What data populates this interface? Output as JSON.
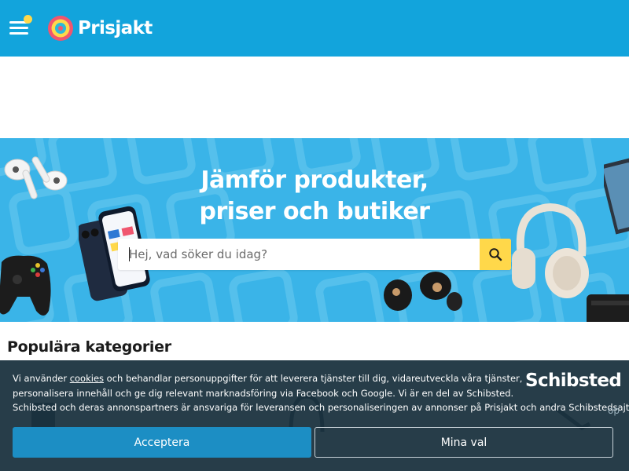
{
  "header": {
    "brand": "Prisjakt",
    "menu_icon": "hamburger-menu-icon",
    "brand_color": "#12a4dc",
    "accent_color": "#ffd84a"
  },
  "hero": {
    "title_line1": "Jämför produkter,",
    "title_line2": "priser och butiker",
    "search_placeholder": "Hej, vad söker du idag?",
    "search_icon": "search-icon",
    "background_color": "#3ab4e8"
  },
  "popular": {
    "title": "Populära kategorier"
  },
  "cookie_banner": {
    "text_prefix": "Vi använder ",
    "cookies_link": "cookies",
    "text_line1_rest": " och behandlar personuppgifter för att leverera tjänster till dig, vidareutveckla våra tjänster,",
    "text_line2": "personalisera innehåll och ge dig relevant marknadsföring via Facebook och Google. Vi är en del av Schibsted.",
    "text_line3": "Schibsted och deras annonspartners är ansvariga för leveransen och personaliseringen av annonser på Prisjakt och andra Schibstedsajter.",
    "partner_logo": "Schibsted",
    "partial_behind": "op",
    "accept_label": "Acceptera",
    "choices_label": "Mina val",
    "accept_color": "#1c8ec4"
  }
}
